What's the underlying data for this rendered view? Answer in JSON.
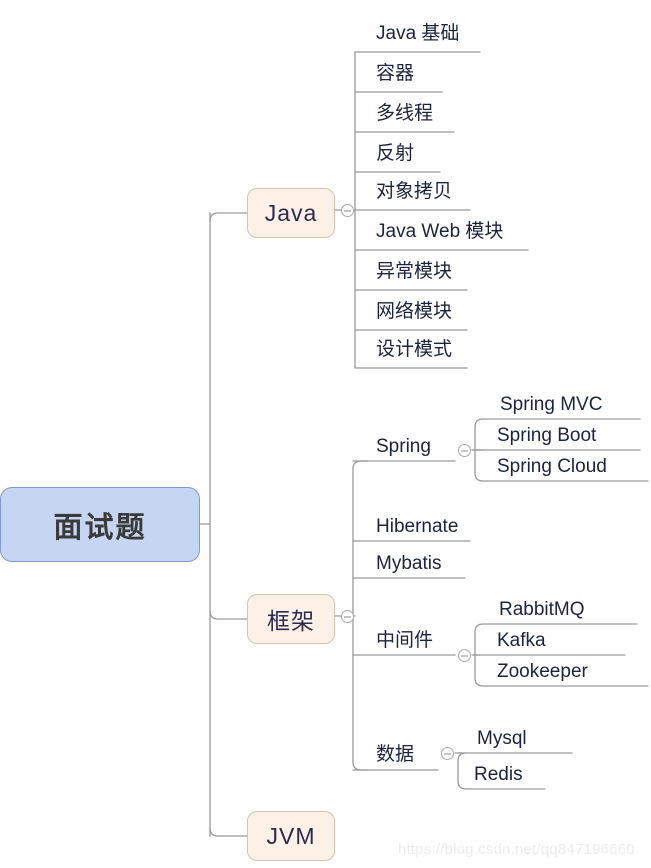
{
  "diagram": {
    "type": "mindmap",
    "title": "面试题",
    "watermark": "https://blog.csdn.net/qq847196660",
    "colors": {
      "root_fill": "#C5D5F2",
      "root_border": "#7F9BC9",
      "topic_fill": "#FDF1E7",
      "topic_border": "#D9C2AC",
      "edge": "#9a9a9a",
      "text": "#1C2340",
      "watermark": "#ECECEC"
    }
  },
  "root": {
    "label": "面试题"
  },
  "branches": [
    {
      "label": "Java",
      "collapsible": true,
      "children": [
        {
          "label": "Java 基础"
        },
        {
          "label": "容器"
        },
        {
          "label": "多线程"
        },
        {
          "label": "反射"
        },
        {
          "label": "对象拷贝"
        },
        {
          "label": "Java Web 模块"
        },
        {
          "label": "异常模块"
        },
        {
          "label": "网络模块"
        },
        {
          "label": "设计模式"
        }
      ]
    },
    {
      "label": "框架",
      "collapsible": true,
      "children": [
        {
          "label": "Spring",
          "collapsible": true,
          "children": [
            {
              "label": "Spring MVC"
            },
            {
              "label": "Spring Boot"
            },
            {
              "label": "Spring Cloud"
            }
          ]
        },
        {
          "label": "Hibernate"
        },
        {
          "label": "Mybatis"
        },
        {
          "label": "中间件",
          "collapsible": true,
          "children": [
            {
              "label": "RabbitMQ"
            },
            {
              "label": "Kafka"
            },
            {
              "label": "Zookeeper"
            }
          ]
        },
        {
          "label": "数据",
          "collapsible": true,
          "children": [
            {
              "label": "Mysql"
            },
            {
              "label": "Redis"
            }
          ]
        }
      ]
    },
    {
      "label": "JVM",
      "collapsible": false,
      "children": []
    }
  ]
}
